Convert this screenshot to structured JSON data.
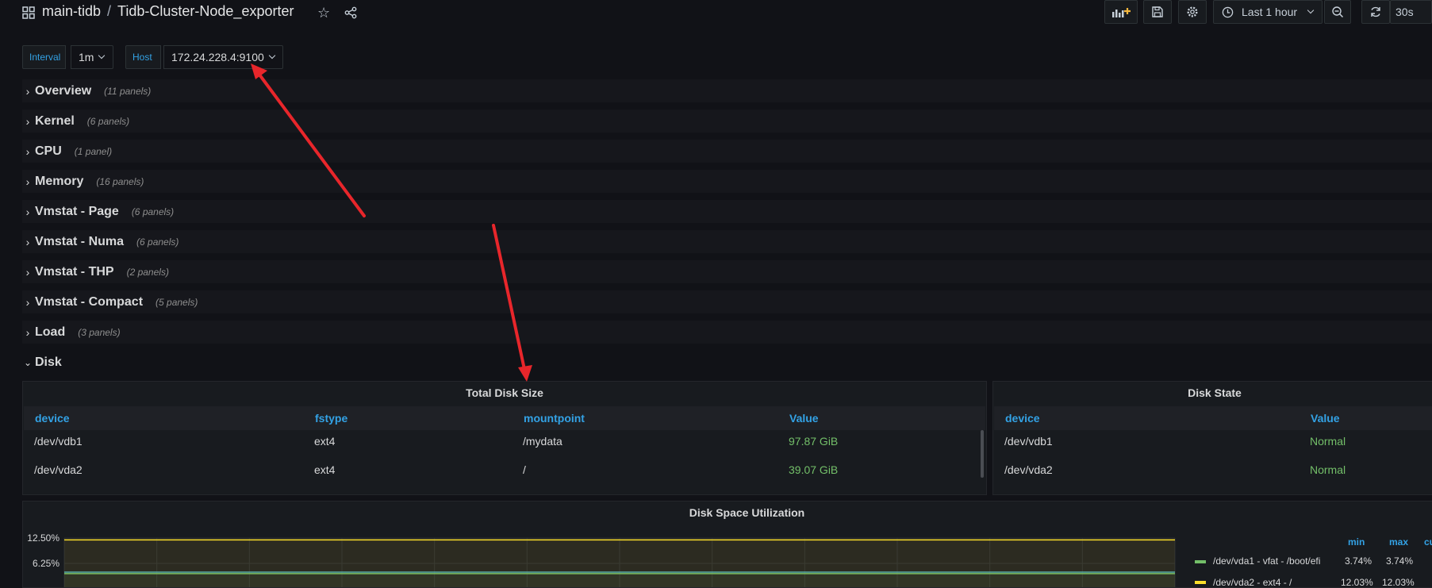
{
  "header": {
    "folder": "main-tidb",
    "separator": "/",
    "dashboard_title": "Tidb-Cluster-Node_exporter",
    "time_range": "Last 1 hour",
    "refresh_interval": "30s"
  },
  "variables": [
    {
      "label": "Interval",
      "value": "1m"
    },
    {
      "label": "Host",
      "value": "172.24.228.4:9100"
    }
  ],
  "rows": [
    {
      "title": "Overview",
      "count": "(11 panels)"
    },
    {
      "title": "Kernel",
      "count": "(6 panels)"
    },
    {
      "title": "CPU",
      "count": "(1 panel)"
    },
    {
      "title": "Memory",
      "count": "(16 panels)"
    },
    {
      "title": "Vmstat - Page",
      "count": "(6 panels)"
    },
    {
      "title": "Vmstat - Numa",
      "count": "(6 panels)"
    },
    {
      "title": "Vmstat - THP",
      "count": "(2 panels)"
    },
    {
      "title": "Vmstat - Compact",
      "count": "(5 panels)"
    },
    {
      "title": "Load",
      "count": "(3 panels)"
    },
    {
      "title": "Disk",
      "count": ""
    }
  ],
  "total_disk_size": {
    "title": "Total Disk Size",
    "columns": [
      "device",
      "fstype",
      "mountpoint",
      "Value"
    ],
    "rows": [
      [
        "/dev/vdb1",
        "ext4",
        "/mydata",
        "97.87 GiB"
      ],
      [
        "/dev/vda2",
        "ext4",
        "/",
        "39.07 GiB"
      ]
    ]
  },
  "disk_state": {
    "title": "Disk State",
    "columns": [
      "device",
      "Value"
    ],
    "rows": [
      [
        "/dev/vdb1",
        "Normal"
      ],
      [
        "/dev/vda2",
        "Normal"
      ]
    ]
  },
  "disk_space": {
    "title": "Disk Space Utilization",
    "legend_columns": [
      "min",
      "max",
      "cu"
    ],
    "legend": [
      {
        "name": "/dev/vda1 - vfat - /boot/efi",
        "min": "3.74%",
        "max": "3.74%",
        "color": "#73bf69"
      },
      {
        "name": "/dev/vda2 - ext4 - /",
        "min": "12.03%",
        "max": "12.03%",
        "color": "#fade2a"
      }
    ]
  },
  "chart_data": {
    "type": "line",
    "title": "Disk Space Utilization",
    "y_tick_labels": [
      "12.50%",
      "6.25%"
    ],
    "series": [
      {
        "name": "/dev/vda1 - vfat - /boot/efi",
        "values": [
          3.74,
          3.74
        ]
      },
      {
        "name": "/dev/vda2 - ext4 - /",
        "values": [
          12.03,
          12.03
        ]
      }
    ]
  },
  "colors": {
    "background": "#111217",
    "panel": "#181b1f",
    "accent_blue": "#33a2e5",
    "value_green": "#73bf69",
    "annotation_red": "#e8262b"
  }
}
